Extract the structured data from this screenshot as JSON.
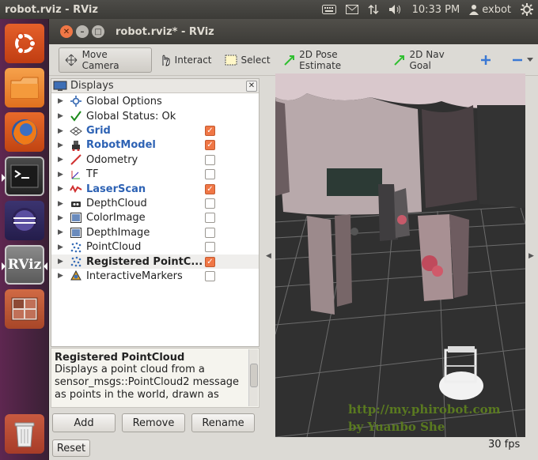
{
  "panel": {
    "app_title": "robot.rviz - RViz",
    "clock": "10:33 PM",
    "user": "exbot",
    "icons": [
      "keyboard-icon",
      "mail-icon",
      "network-icon",
      "volume-icon",
      "user-icon",
      "gear-icon"
    ]
  },
  "launcher": {
    "items": [
      {
        "name": "ubuntu-dash",
        "color": "#dd4814"
      },
      {
        "name": "files",
        "color": "#f08a24"
      },
      {
        "name": "firefox",
        "color": "#e66000"
      },
      {
        "name": "terminal",
        "color": "#2b2b2b"
      },
      {
        "name": "eclipse",
        "color": "#2c2255"
      },
      {
        "name": "rviz",
        "color": "#6c6c6c",
        "label": "RViz"
      },
      {
        "name": "workspace-switcher",
        "color": "#c05a3c"
      },
      {
        "name": "trash",
        "color": "#b84030"
      }
    ]
  },
  "window": {
    "title": "robot.rviz* - RViz"
  },
  "toolbar": {
    "move_camera": "Move Camera",
    "interact": "Interact",
    "select": "Select",
    "pose_estimate": "2D Pose Estimate",
    "nav_goal": "2D Nav Goal"
  },
  "displays": {
    "header": "Displays",
    "items": [
      {
        "label": "Global Options",
        "icon": "gear-icon",
        "style": "normal",
        "check": null
      },
      {
        "label": "Global Status: Ok",
        "icon": "checkmark-icon",
        "style": "normal",
        "check": null
      },
      {
        "label": "Grid",
        "icon": "grid-icon",
        "style": "blue",
        "check": true
      },
      {
        "label": "RobotModel",
        "icon": "robot-icon",
        "style": "blue",
        "check": true
      },
      {
        "label": "Odometry",
        "icon": "odometry-icon",
        "style": "normal",
        "check": false
      },
      {
        "label": "TF",
        "icon": "tf-icon",
        "style": "normal",
        "check": false
      },
      {
        "label": "LaserScan",
        "icon": "laser-icon",
        "style": "blue",
        "check": true
      },
      {
        "label": "DepthCloud",
        "icon": "depthcloud-icon",
        "style": "normal",
        "check": false
      },
      {
        "label": "ColorImage",
        "icon": "image-icon",
        "style": "normal",
        "check": false
      },
      {
        "label": "DepthImage",
        "icon": "image-icon",
        "style": "normal",
        "check": false
      },
      {
        "label": "PointCloud",
        "icon": "pointcloud-icon",
        "style": "normal",
        "check": false
      },
      {
        "label": "Registered PointC...",
        "icon": "pointcloud-icon",
        "style": "selected",
        "check": true
      },
      {
        "label": "InteractiveMarkers",
        "icon": "markers-icon",
        "style": "normal",
        "check": false
      }
    ]
  },
  "description": {
    "title": "Registered PointCloud",
    "text": "Displays a point cloud from a sensor_msgs::PointCloud2 message as points in the world, drawn as"
  },
  "buttons": {
    "add": "Add",
    "remove": "Remove",
    "rename": "Rename",
    "reset": "Reset"
  },
  "viewport": {
    "watermark_line1": "http://my.phirobot.com",
    "watermark_line2": "by Yuanbo She"
  },
  "status": {
    "fps": "30 fps"
  },
  "colors": {
    "accent_orange": "#f07746",
    "label_blue": "#2d62b4",
    "launcher_bg": "#5e2750",
    "viewport_bg": "#303030"
  }
}
